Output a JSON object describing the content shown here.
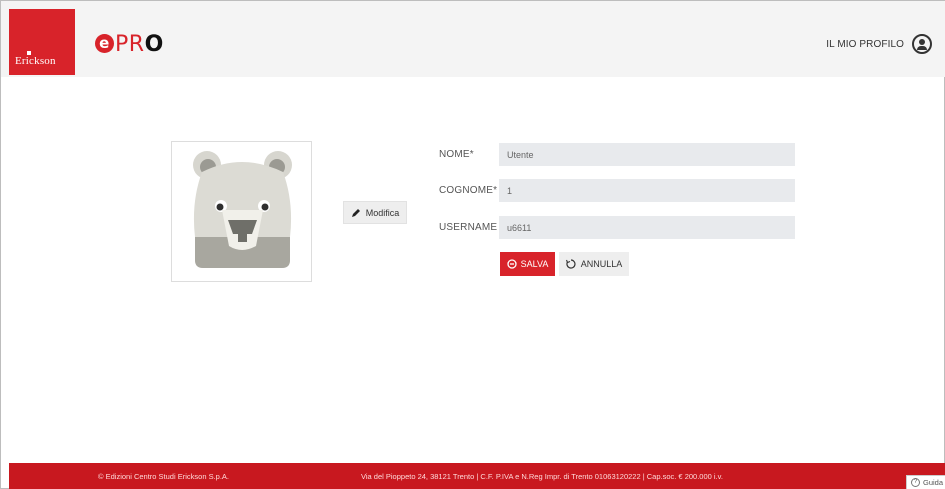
{
  "brand": {
    "publisher": "Erickson",
    "app_logo_e": "e",
    "app_logo_pro_p": "P",
    "app_logo_pro_r": "R",
    "app_logo_pro_o": "O"
  },
  "header": {
    "profile_label": "IL MIO PROFILO"
  },
  "avatar": {
    "edit_label": "Modifica"
  },
  "form": {
    "nome_label": "NOME*",
    "nome_value": "Utente",
    "cognome_label": "COGNOME*",
    "cognome_value": "1",
    "username_label": "USERNAME",
    "username_value": "u6611",
    "save_label": "SALVA",
    "cancel_label": "ANNULLA"
  },
  "footer": {
    "copyright": "© Edizioni Centro Studi Erickson S.p.A.",
    "address": "Via del Pioppeto 24, 38121 Trento | C.F. P.IVA e N.Reg Impr. di Trento 01063120222 | Cap.soc. € 200.000 i.v."
  },
  "help": {
    "label": "Guida"
  },
  "colors": {
    "accent": "#d8232a",
    "footer_bg": "#c8181f",
    "header_bg": "#f4f4f4",
    "input_bg": "#e8eaed"
  },
  "icons": [
    "profile-icon",
    "pencil-icon",
    "save-icon",
    "undo-icon",
    "help-icon"
  ]
}
